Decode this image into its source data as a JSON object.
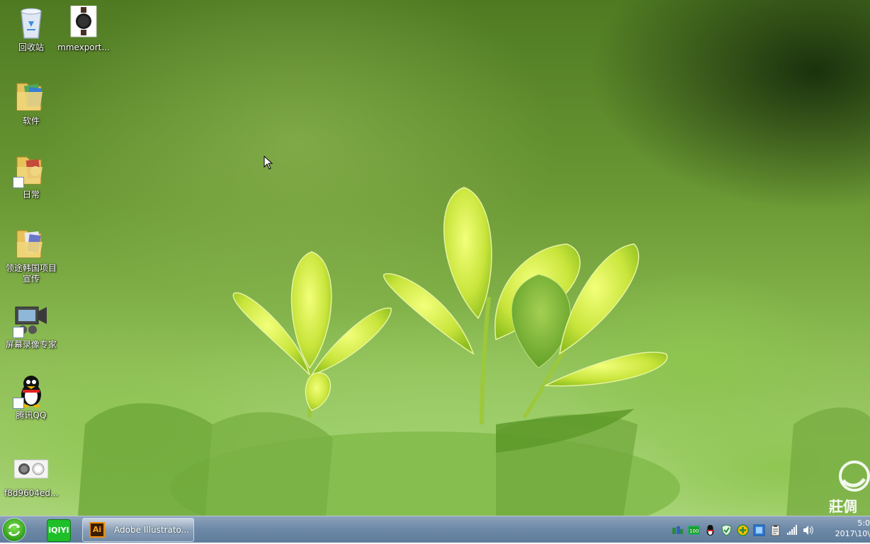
{
  "desktop": {
    "icons": [
      {
        "label": "回收站",
        "icon": "recycle-bin-icon"
      },
      {
        "label": "mmexport...",
        "icon": "watch-image-icon"
      },
      {
        "label": "软件",
        "icon": "folder-icon"
      },
      {
        "label": "日常",
        "icon": "folder-shortcut-icon"
      },
      {
        "label": "领途韩国项目宣传",
        "icon": "folder-icon"
      },
      {
        "label": "屏幕录像专家",
        "icon": "screen-recorder-icon"
      },
      {
        "label": "腾讯QQ",
        "icon": "qq-penguin-icon"
      },
      {
        "label": "f8d9604ed...",
        "icon": "image-file-icon"
      }
    ],
    "watermark_text": "莊倜"
  },
  "taskbar": {
    "start_icon": "start-orb-icon",
    "pinned": [
      {
        "label": "iQIYI",
        "icon": "iqiyi-icon"
      }
    ],
    "tasks": [
      {
        "label": "Adobe Illustrato...",
        "icon": "illustrator-icon",
        "badge": "Ai"
      }
    ],
    "tray_icons": [
      "network-status-icon",
      "battery-meter-icon",
      "qq-tray-icon",
      "security-shield-icon",
      "plus-update-icon",
      "blue-app-icon",
      "clipboard-icon",
      "signal-bars-icon",
      "volume-icon"
    ],
    "clock": {
      "time": "5:0",
      "date": "2017\\10\\"
    }
  }
}
